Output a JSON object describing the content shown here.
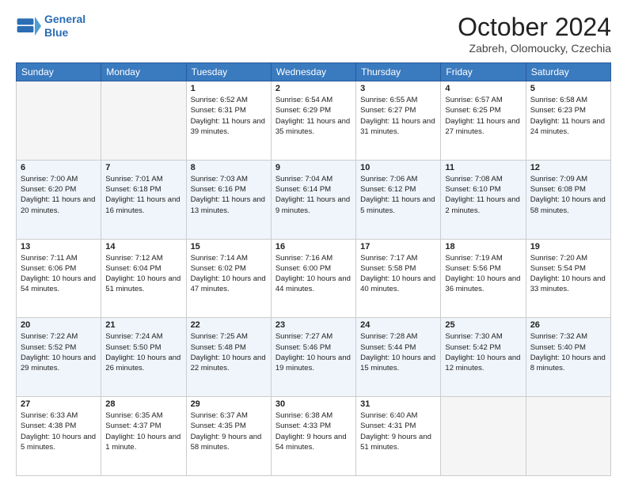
{
  "header": {
    "logo_line1": "General",
    "logo_line2": "Blue",
    "month": "October 2024",
    "location": "Zabreh, Olomoucky, Czechia"
  },
  "weekdays": [
    "Sunday",
    "Monday",
    "Tuesday",
    "Wednesday",
    "Thursday",
    "Friday",
    "Saturday"
  ],
  "weeks": [
    [
      {
        "day": "",
        "empty": true
      },
      {
        "day": "",
        "empty": true
      },
      {
        "day": "1",
        "sunrise": "6:52 AM",
        "sunset": "6:31 PM",
        "daylight": "11 hours and 39 minutes."
      },
      {
        "day": "2",
        "sunrise": "6:54 AM",
        "sunset": "6:29 PM",
        "daylight": "11 hours and 35 minutes."
      },
      {
        "day": "3",
        "sunrise": "6:55 AM",
        "sunset": "6:27 PM",
        "daylight": "11 hours and 31 minutes."
      },
      {
        "day": "4",
        "sunrise": "6:57 AM",
        "sunset": "6:25 PM",
        "daylight": "11 hours and 27 minutes."
      },
      {
        "day": "5",
        "sunrise": "6:58 AM",
        "sunset": "6:23 PM",
        "daylight": "11 hours and 24 minutes."
      }
    ],
    [
      {
        "day": "6",
        "sunrise": "7:00 AM",
        "sunset": "6:20 PM",
        "daylight": "11 hours and 20 minutes."
      },
      {
        "day": "7",
        "sunrise": "7:01 AM",
        "sunset": "6:18 PM",
        "daylight": "11 hours and 16 minutes."
      },
      {
        "day": "8",
        "sunrise": "7:03 AM",
        "sunset": "6:16 PM",
        "daylight": "11 hours and 13 minutes."
      },
      {
        "day": "9",
        "sunrise": "7:04 AM",
        "sunset": "6:14 PM",
        "daylight": "11 hours and 9 minutes."
      },
      {
        "day": "10",
        "sunrise": "7:06 AM",
        "sunset": "6:12 PM",
        "daylight": "11 hours and 5 minutes."
      },
      {
        "day": "11",
        "sunrise": "7:08 AM",
        "sunset": "6:10 PM",
        "daylight": "11 hours and 2 minutes."
      },
      {
        "day": "12",
        "sunrise": "7:09 AM",
        "sunset": "6:08 PM",
        "daylight": "10 hours and 58 minutes."
      }
    ],
    [
      {
        "day": "13",
        "sunrise": "7:11 AM",
        "sunset": "6:06 PM",
        "daylight": "10 hours and 54 minutes."
      },
      {
        "day": "14",
        "sunrise": "7:12 AM",
        "sunset": "6:04 PM",
        "daylight": "10 hours and 51 minutes."
      },
      {
        "day": "15",
        "sunrise": "7:14 AM",
        "sunset": "6:02 PM",
        "daylight": "10 hours and 47 minutes."
      },
      {
        "day": "16",
        "sunrise": "7:16 AM",
        "sunset": "6:00 PM",
        "daylight": "10 hours and 44 minutes."
      },
      {
        "day": "17",
        "sunrise": "7:17 AM",
        "sunset": "5:58 PM",
        "daylight": "10 hours and 40 minutes."
      },
      {
        "day": "18",
        "sunrise": "7:19 AM",
        "sunset": "5:56 PM",
        "daylight": "10 hours and 36 minutes."
      },
      {
        "day": "19",
        "sunrise": "7:20 AM",
        "sunset": "5:54 PM",
        "daylight": "10 hours and 33 minutes."
      }
    ],
    [
      {
        "day": "20",
        "sunrise": "7:22 AM",
        "sunset": "5:52 PM",
        "daylight": "10 hours and 29 minutes."
      },
      {
        "day": "21",
        "sunrise": "7:24 AM",
        "sunset": "5:50 PM",
        "daylight": "10 hours and 26 minutes."
      },
      {
        "day": "22",
        "sunrise": "7:25 AM",
        "sunset": "5:48 PM",
        "daylight": "10 hours and 22 minutes."
      },
      {
        "day": "23",
        "sunrise": "7:27 AM",
        "sunset": "5:46 PM",
        "daylight": "10 hours and 19 minutes."
      },
      {
        "day": "24",
        "sunrise": "7:28 AM",
        "sunset": "5:44 PM",
        "daylight": "10 hours and 15 minutes."
      },
      {
        "day": "25",
        "sunrise": "7:30 AM",
        "sunset": "5:42 PM",
        "daylight": "10 hours and 12 minutes."
      },
      {
        "day": "26",
        "sunrise": "7:32 AM",
        "sunset": "5:40 PM",
        "daylight": "10 hours and 8 minutes."
      }
    ],
    [
      {
        "day": "27",
        "sunrise": "6:33 AM",
        "sunset": "4:38 PM",
        "daylight": "10 hours and 5 minutes."
      },
      {
        "day": "28",
        "sunrise": "6:35 AM",
        "sunset": "4:37 PM",
        "daylight": "10 hours and 1 minute."
      },
      {
        "day": "29",
        "sunrise": "6:37 AM",
        "sunset": "4:35 PM",
        "daylight": "9 hours and 58 minutes."
      },
      {
        "day": "30",
        "sunrise": "6:38 AM",
        "sunset": "4:33 PM",
        "daylight": "9 hours and 54 minutes."
      },
      {
        "day": "31",
        "sunrise": "6:40 AM",
        "sunset": "4:31 PM",
        "daylight": "9 hours and 51 minutes."
      },
      {
        "day": "",
        "empty": true
      },
      {
        "day": "",
        "empty": true
      }
    ]
  ]
}
